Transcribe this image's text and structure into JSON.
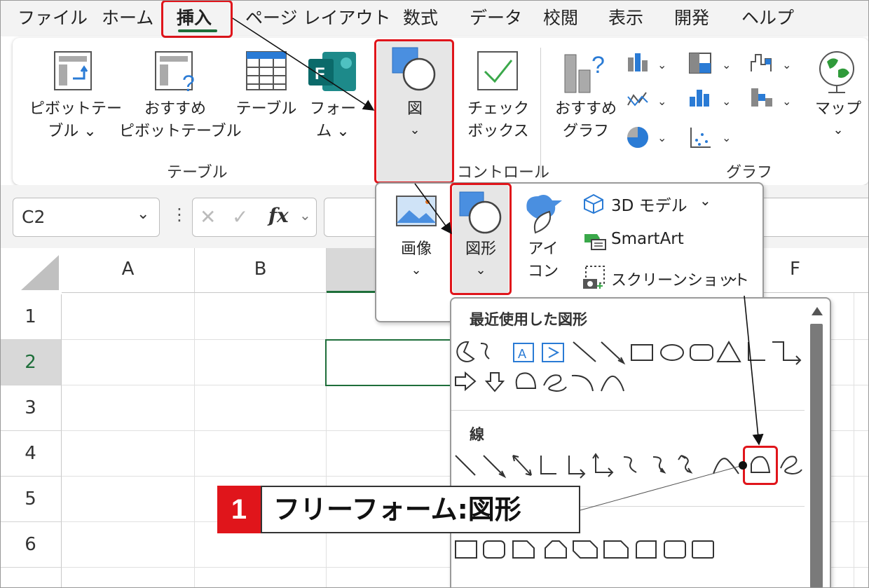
{
  "menu_tabs": [
    "ファイル",
    "ホーム",
    "挿入",
    "ページ レイアウト",
    "数式",
    "データ",
    "校閲",
    "表示",
    "開発",
    "ヘルプ"
  ],
  "ribbon": {
    "pivot_table": {
      "line1": "ピボットテー",
      "line2": "ブル ⌄"
    },
    "recommended_pivot": {
      "line1": "おすすめ",
      "line2": "ピボットテーブル"
    },
    "table": "テーブル",
    "forms": {
      "line1": "フォー",
      "line2": "ム ⌄"
    },
    "illustrations": {
      "label": "図",
      "chevron": "⌄"
    },
    "checkbox": {
      "line1": "チェック",
      "line2": "ボックス"
    },
    "recommended_charts": {
      "line1": "おすすめ",
      "line2": "グラフ"
    },
    "maps": {
      "label": "マップ",
      "chevron": "⌄"
    },
    "group_table": "テーブル",
    "group_controls": "コントロール",
    "group_charts": "グラフ"
  },
  "formula_bar": {
    "name_box": "C2",
    "fx": "fx"
  },
  "columns": [
    "A",
    "B",
    "F"
  ],
  "rows": [
    "1",
    "2",
    "3",
    "4",
    "5",
    "6"
  ],
  "illustrations_menu": {
    "pictures": "画像",
    "shapes": "図形",
    "icons": {
      "line1": "アイ",
      "line2": "コン"
    },
    "models3d": "3D モデル",
    "smartart": "SmartArt",
    "screenshot": "スクリーンショット"
  },
  "shapes_gallery": {
    "recent_title": "最近使用した図形",
    "lines_title": "線"
  },
  "callout": {
    "number": "1",
    "text": "フリーフォーム:図形"
  },
  "colors": {
    "accent_red": "#e0151b",
    "excel_green": "#1e6e3a",
    "shape_blue": "#4a8fe0"
  }
}
